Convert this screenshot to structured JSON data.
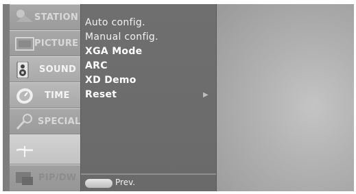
{
  "sidebar": {
    "items": [
      {
        "label": "STATION",
        "icon": "station-icon",
        "state": "dim"
      },
      {
        "label": "PICTURE",
        "icon": "picture-icon",
        "state": "dim"
      },
      {
        "label": "SOUND",
        "icon": "speaker-icon",
        "state": "normal"
      },
      {
        "label": "TIME",
        "icon": "clock-icon",
        "state": "normal"
      },
      {
        "label": "SPECIAL",
        "icon": "special-icon",
        "state": "dim"
      },
      {
        "label": "",
        "icon": "screen-adjust-icon",
        "state": "active"
      },
      {
        "label": "PIP/DW",
        "icon": "pip-icon",
        "state": "faded"
      }
    ]
  },
  "submenu": {
    "items": [
      {
        "label": "Auto config.",
        "style": "plain"
      },
      {
        "label": "Manual config.",
        "style": "plain"
      },
      {
        "label": "XGA Mode",
        "style": "bold"
      },
      {
        "label": "ARC",
        "style": "bold"
      },
      {
        "label": "XD Demo",
        "style": "bold"
      },
      {
        "label": "Reset",
        "style": "bold",
        "arrow": "▶"
      }
    ]
  },
  "footer": {
    "prev_label": "Prev."
  }
}
